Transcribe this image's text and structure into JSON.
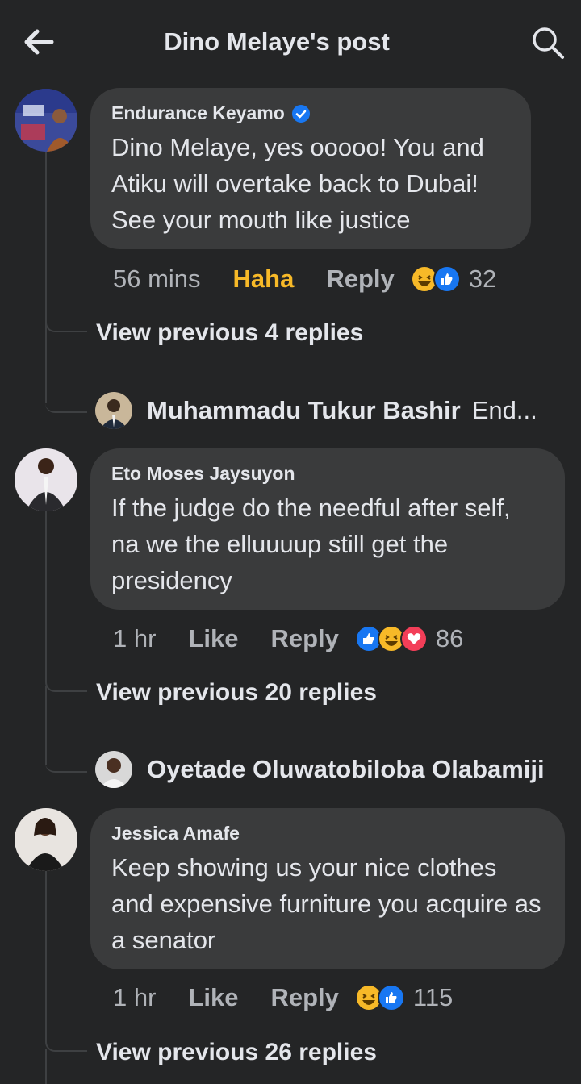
{
  "header": {
    "title": "Dino Melaye's post",
    "back_icon": "arrow-left-icon",
    "search_icon": "search-icon"
  },
  "comments": [
    {
      "author": "Endurance Keyamo",
      "verified": true,
      "text": "Dino Melaye, yes ooooo! You and Atiku will overtake back to Dubai! See your mouth like justice",
      "time": "56 mins",
      "reaction_label": "Haha",
      "reaction_label_color": "#f7b928",
      "reply_label": "Reply",
      "reactions": [
        "haha",
        "like"
      ],
      "reaction_count": "32",
      "view_previous": "View previous 4 replies",
      "latest_reply": {
        "name": "Muhammadu Tukur Bashir",
        "snippet": "End..."
      }
    },
    {
      "author": "Eto Moses Jaysuyon",
      "verified": false,
      "text": "If the judge do the needful after self, na we the  elluuuup still get the presidency",
      "time": "1 hr",
      "reaction_label": "Like",
      "reaction_label_color": "#b0b3b8",
      "reply_label": "Reply",
      "reactions": [
        "like",
        "haha",
        "love"
      ],
      "reaction_count": "86",
      "view_previous": "View previous 20 replies",
      "latest_reply": {
        "name": "Oyetade Oluwatobiloba Olabamiji",
        "snippet": ""
      }
    },
    {
      "author": "Jessica Amafe",
      "verified": false,
      "text": "Keep showing us your nice clothes and expensive furniture you acquire as a senator",
      "time": "1 hr",
      "reaction_label": "Like",
      "reaction_label_color": "#b0b3b8",
      "reply_label": "Reply",
      "reactions": [
        "haha",
        "like"
      ],
      "reaction_count": "115",
      "view_previous": "View previous 26 replies"
    }
  ],
  "colors": {
    "background": "#242526",
    "bubble": "#3a3b3c",
    "secondary_text": "#b0b3b8",
    "like_blue": "#1877f2",
    "love_red": "#f33e58",
    "haha_yellow": "#f7b928"
  }
}
